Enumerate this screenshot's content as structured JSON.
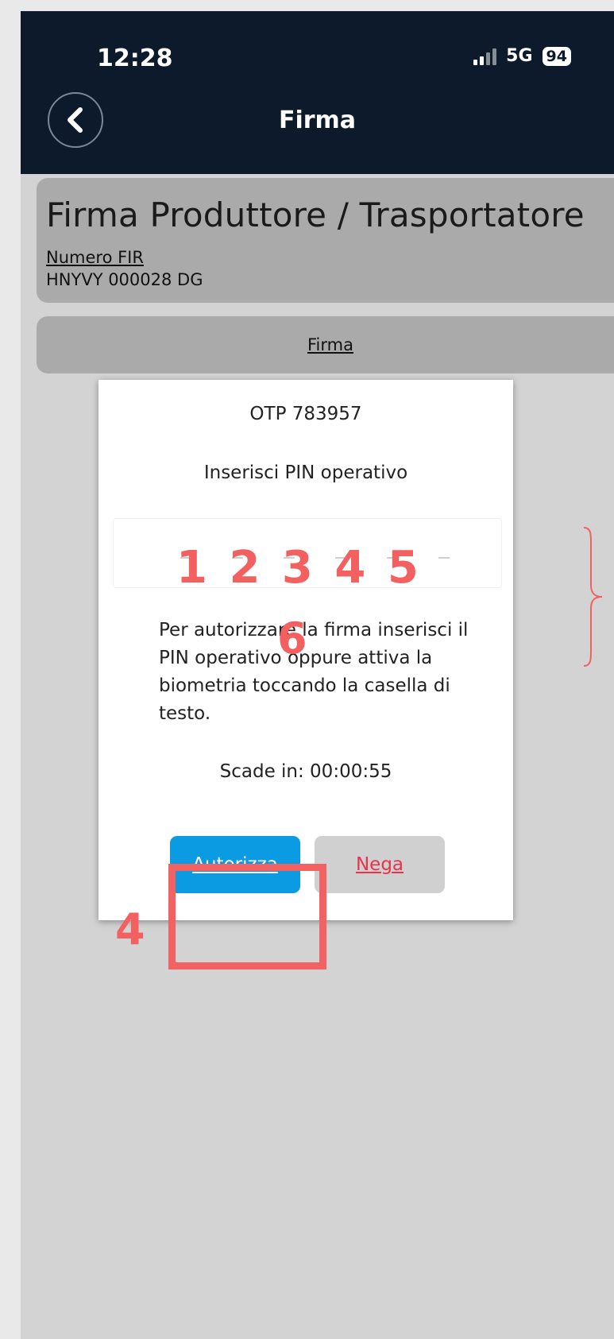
{
  "status_bar": {
    "time": "12:28",
    "network": "5G",
    "battery": "94"
  },
  "nav": {
    "title": "Firma",
    "back_icon": "chevron-left-icon"
  },
  "header": {
    "title": "Firma Produttore / Trasportatore",
    "fir_label": "Numero FIR",
    "fir_value": "HNYVY 000028 DG"
  },
  "tab": {
    "label": "Firma"
  },
  "dialog": {
    "otp": "OTP 783957",
    "pin_prompt": "Inserisci PIN operativo",
    "help_text": "Per autorizzare la firma inserisci il PIN operativo oppure attiva la biometria toccando la casella di testo.",
    "expire": "Scade in: 00:00:55",
    "authorize_label": "Autorizza",
    "deny_label": "Nega"
  },
  "annotations": {
    "pin_digits": "1 2 3 4 5",
    "sixth_digit": "6",
    "button_step": "4"
  },
  "colors": {
    "topbar": "#0c1a2b",
    "authorize": "#0a9be3",
    "deny_text": "#e8334a",
    "annotation": "#f26060"
  }
}
